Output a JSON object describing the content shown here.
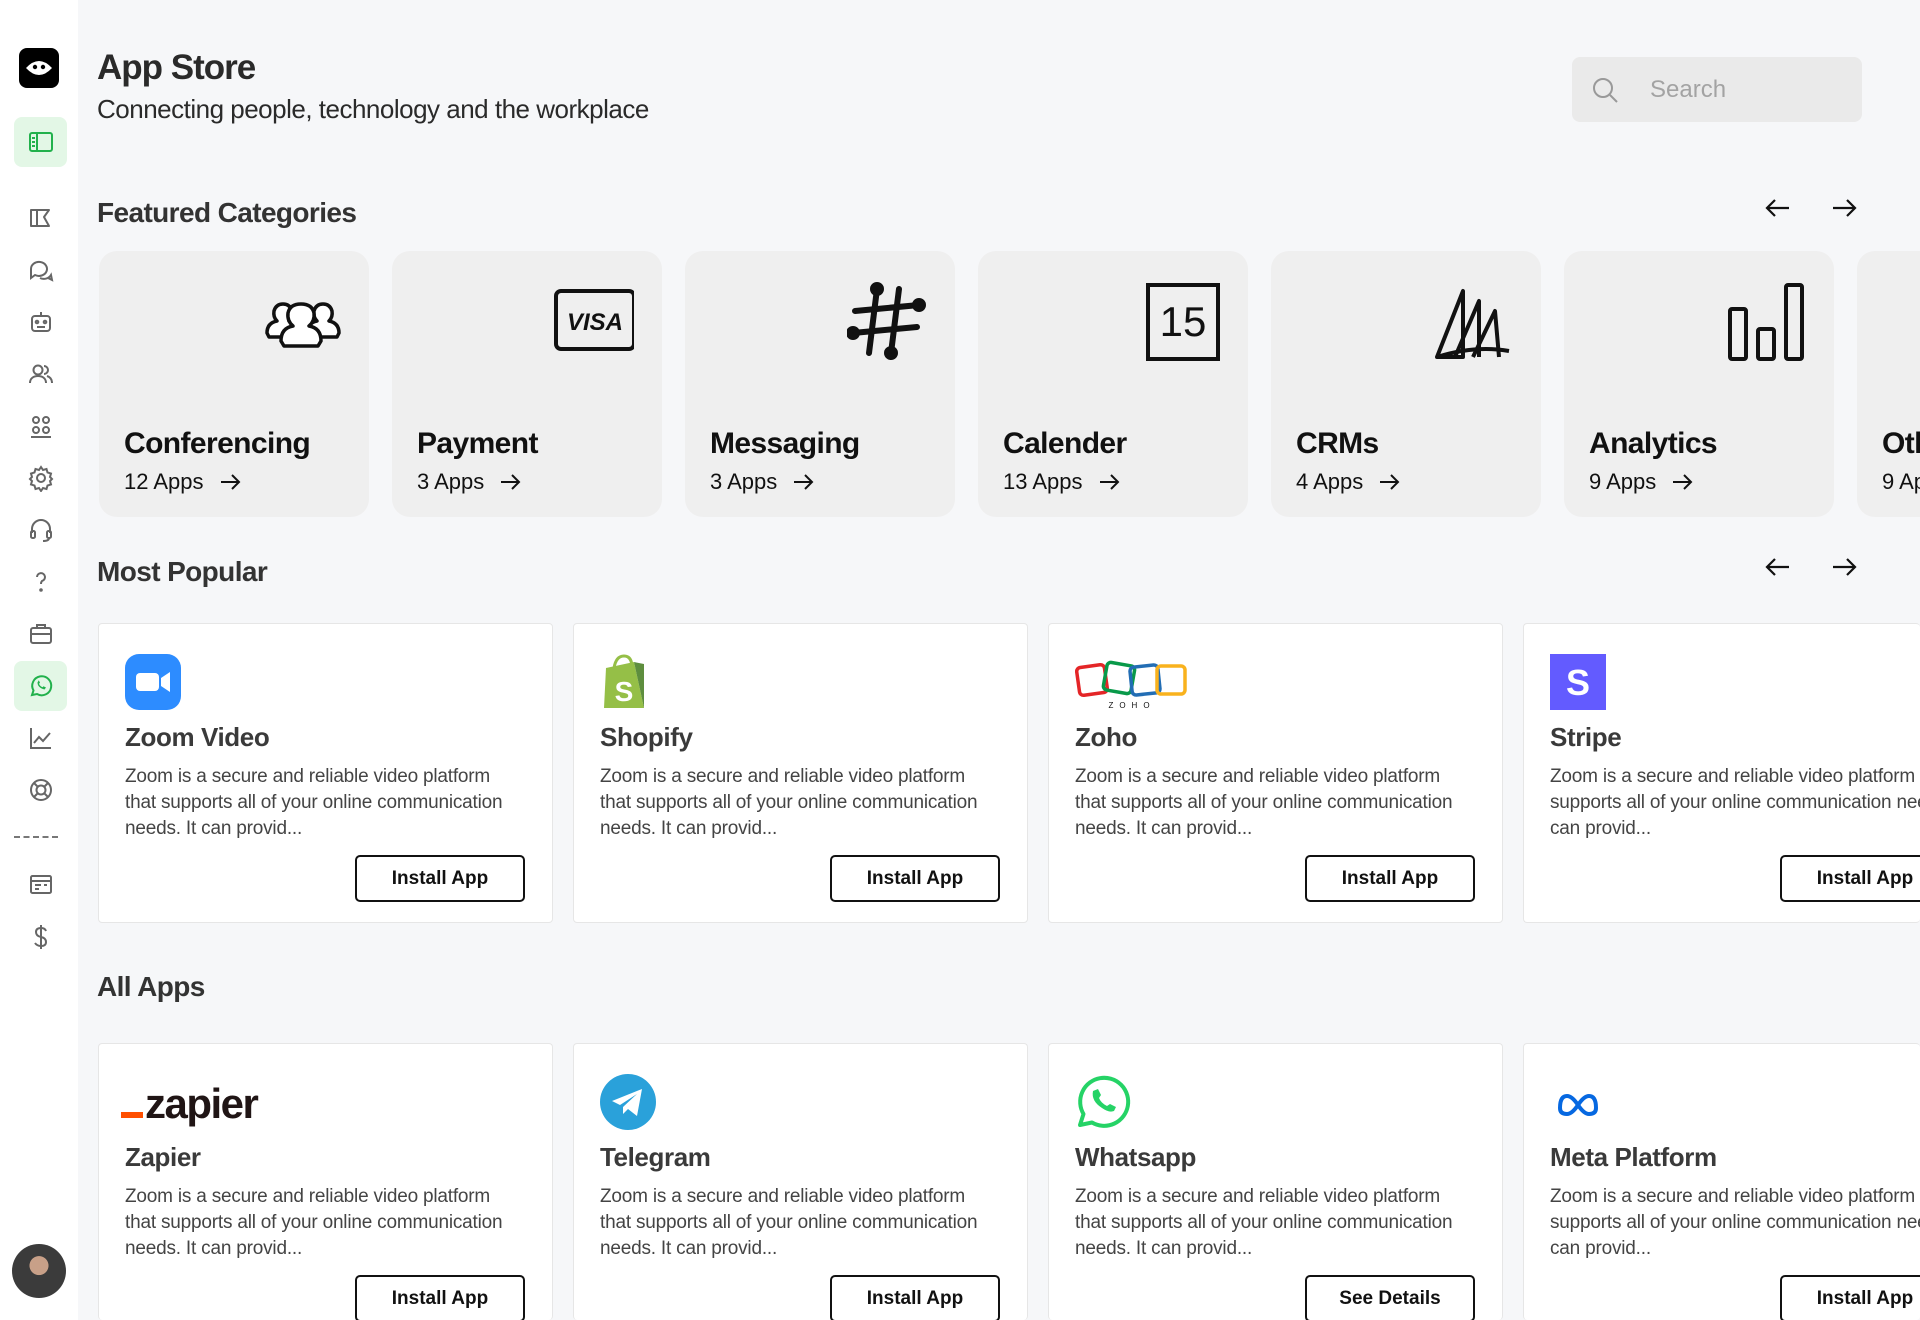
{
  "header": {
    "title": "App Store",
    "subtitle": "Connecting people, technology and the workplace",
    "search_placeholder": "Search"
  },
  "sidebar": {
    "icons": [
      "panel-icon",
      "megaphone-icon",
      "chat-icon",
      "bot-icon",
      "users-icon",
      "team-icon",
      "gear-icon",
      "headset-icon",
      "question-icon",
      "briefcase-icon",
      "whatsapp-icon",
      "chart-line-icon",
      "lifebuoy-icon",
      "receipt-icon",
      "dollar-icon"
    ]
  },
  "featured": {
    "title": "Featured Categories",
    "categories": [
      {
        "name": "Conferencing",
        "count": "12 Apps"
      },
      {
        "name": "Payment",
        "count": "3 Apps"
      },
      {
        "name": "Messaging",
        "count": "3 Apps"
      },
      {
        "name": "Calender",
        "count": "13 Apps"
      },
      {
        "name": "CRMs",
        "count": "4 Apps"
      },
      {
        "name": "Analytics",
        "count": "9 Apps"
      },
      {
        "name": "Oth",
        "count": "9 Ap"
      }
    ],
    "calendar_day": "15",
    "visa_text": "VISA"
  },
  "popular": {
    "title": "Most Popular",
    "apps": [
      {
        "name": "Zoom Video",
        "desc": "Zoom is a secure and reliable video platform that supports all of your online communication needs. It can provid...",
        "button": "Install App"
      },
      {
        "name": "Shopify",
        "desc": "Zoom is a secure and reliable video platform that supports all of your online communication needs. It can provid...",
        "button": "Install App"
      },
      {
        "name": "Zoho",
        "desc": "Zoom is a secure and reliable video platform that supports all of your online communication needs. It can provid...",
        "button": "Install App"
      },
      {
        "name": "Stripe",
        "desc": "Zoom is a secure and reliable video platform that supports all of your online communication needs. It can provid...",
        "button": "Install App"
      }
    ]
  },
  "all_apps": {
    "title": "All Apps",
    "apps": [
      {
        "name": "Zapier",
        "desc": "Zoom is a secure and reliable video platform that supports all of your online communication needs. It can provid...",
        "button": "Install App"
      },
      {
        "name": "Telegram",
        "desc": "Zoom is a secure and reliable video platform that supports all of your online communication needs. It can provid...",
        "button": "Install App"
      },
      {
        "name": "Whatsapp",
        "desc": "Zoom is a secure and reliable video platform that supports all of your online communication needs. It can provid...",
        "button": "See Details"
      },
      {
        "name": "Meta Platform",
        "desc": "Zoom is a secure and reliable video platform that supports all of your online communication needs. It can provid...",
        "button": "Install App"
      }
    ]
  },
  "logos": {
    "zapier_word": "zapier",
    "zoho_word": "ZOHO",
    "stripe_letter": "S",
    "shopify_letter": "S"
  },
  "colors": {
    "accent_green": "#25d366",
    "active_bg": "#e3f7e6",
    "zoom_blue": "#2d8cff",
    "stripe_purple": "#635bff",
    "telegram_blue": "#2aa1da",
    "zapier_orange": "#ff4f00",
    "shopify_green": "#95bf47",
    "meta_blue": "#0668e1"
  }
}
